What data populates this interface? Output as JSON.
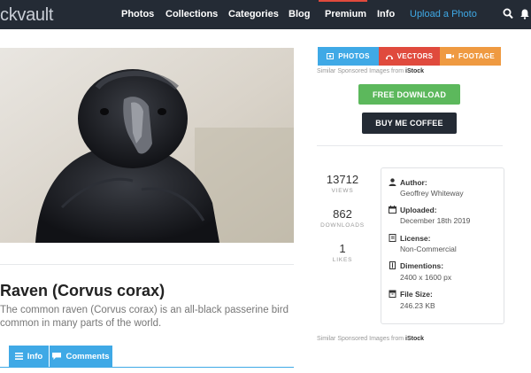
{
  "nav": {
    "logo": "ckvault",
    "items": [
      "Photos",
      "Collections",
      "Categories",
      "Blog",
      "Premium",
      "Info"
    ],
    "upload_label": "Upload a Photo"
  },
  "image": {
    "alt": "Raven (Corvus corax)"
  },
  "photo": {
    "title": "Raven (Corvus corax)",
    "description": "The common raven (Corvus corax) is an all-black passerine bird common in many parts of the world."
  },
  "tabs": {
    "info": "Info",
    "comments": "Comments"
  },
  "sources": {
    "photos": "PHOTOS",
    "vectors": "VECTORS",
    "footage": "FOOTAGE",
    "sponsored_prefix": "Similar Sponsored Images from",
    "sponsored_brand": "iStock"
  },
  "buttons": {
    "free_download": "FREE DOWNLOAD",
    "buy_coffee": "BUY ME COFFEE"
  },
  "stats": {
    "views": "13712",
    "views_label": "VIEWS",
    "downloads": "862",
    "downloads_label": "DOWNLOADS",
    "likes": "1",
    "likes_label": "LIKES"
  },
  "meta": {
    "author_label": "Author:",
    "author": "Geoffrey Whiteway",
    "uploaded_label": "Uploaded:",
    "uploaded": "December 18th 2019",
    "license_label": "License:",
    "license": "Non-Commercial",
    "dimensions_label": "Dimentions:",
    "dimensions": "2400 x 1600 px",
    "filesize_label": "File Size:",
    "filesize": "246.23 KB"
  },
  "colors": {
    "nav_bg": "#242b35",
    "accent_blue": "#3fa9e6",
    "photos_tab": "#3fa9e6",
    "vectors_tab": "#e04a3d",
    "footage_tab": "#ef9a41",
    "download_green": "#5cb85c",
    "coffee_dark": "#242b35"
  }
}
